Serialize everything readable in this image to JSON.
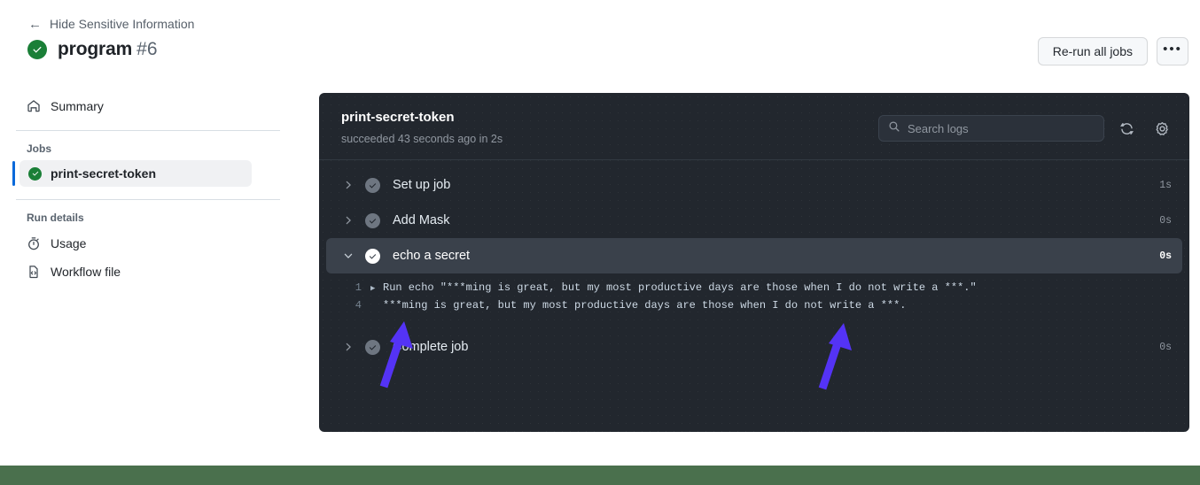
{
  "header": {
    "back_label": "Hide Sensitive Information",
    "back_icon": "arrow-left-icon",
    "status_icon": "check-circle-icon",
    "run_name": "program",
    "run_number": "#6"
  },
  "top_actions": {
    "rerun_label": "Re-run all jobs",
    "kebab_label": "•••"
  },
  "sidebar": {
    "summary": {
      "label": "Summary",
      "icon": "home-icon"
    },
    "jobs_group_title": "Jobs",
    "jobs": [
      {
        "label": "print-secret-token",
        "icon": "check-circle-icon",
        "selected": true
      }
    ],
    "run_details_title": "Run details",
    "details": [
      {
        "label": "Usage",
        "icon": "stopwatch-icon"
      },
      {
        "label": "Workflow file",
        "icon": "file-code-icon"
      }
    ]
  },
  "logs": {
    "job_name": "print-secret-token",
    "job_status": "succeeded 43 seconds ago in 2s",
    "search": {
      "placeholder": "Search logs",
      "icon": "search-icon"
    },
    "refresh_icon": "refresh-icon",
    "settings_icon": "gear-icon",
    "steps": [
      {
        "label": "Set up job",
        "duration": "1s",
        "expanded": false,
        "icon": "check-circle-icon"
      },
      {
        "label": "Add Mask",
        "duration": "0s",
        "expanded": false,
        "icon": "check-circle-icon"
      },
      {
        "label": "echo a secret",
        "duration": "0s",
        "expanded": true,
        "icon": "check-circle-icon"
      },
      {
        "label": "Complete job",
        "duration": "0s",
        "expanded": false,
        "icon": "check-circle-icon"
      }
    ],
    "output_lines": [
      {
        "number": "1",
        "caret": "▶",
        "text": "Run echo \"***ming is great, but my most productive days are those when I do not write a ***.\""
      },
      {
        "number": "4",
        "caret": "",
        "text": "***ming is great, but my most productive days are those when I do not write a ***."
      }
    ]
  },
  "annotations": {
    "arrow_color": "#5433f5",
    "arrows": [
      {
        "name": "arrow-pointing-at-masked-secret-left"
      },
      {
        "name": "arrow-pointing-at-masked-secret-right"
      }
    ]
  },
  "colors": {
    "accent_blue": "#0969da",
    "success_green": "#1a7f37",
    "panel_bg": "#22272e",
    "band_green": "#4a704d"
  }
}
